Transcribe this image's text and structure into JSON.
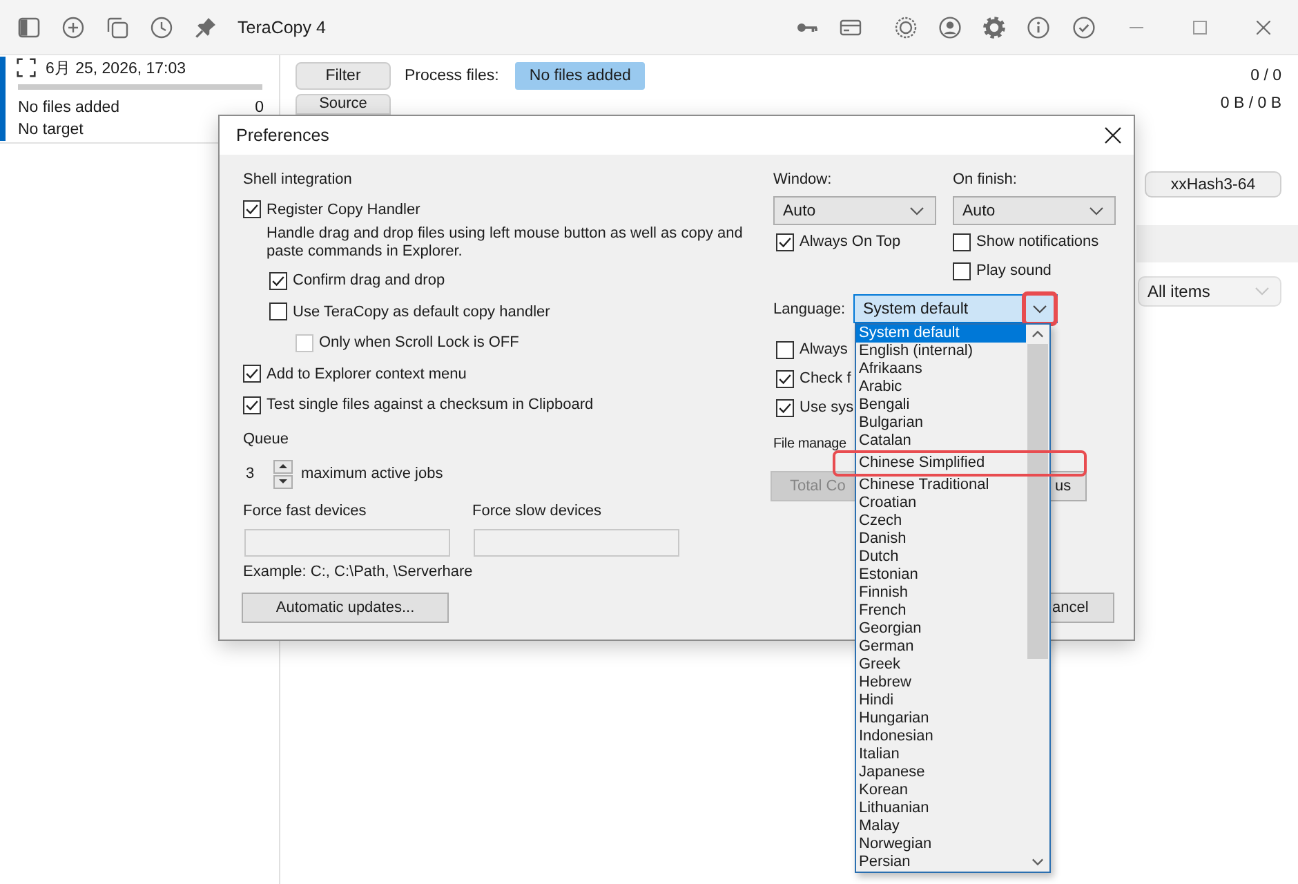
{
  "window": {
    "title": "TeraCopy 4"
  },
  "sidebar": {
    "jobs": [
      {
        "date": "6月 25, 2026, 17:03",
        "level": 0,
        "status": "No files added",
        "count": "0",
        "target": "No target",
        "selected": true
      }
    ]
  },
  "main": {
    "filter_button": "Filter",
    "process_label": "Process files:",
    "process_status": "No files added",
    "file_count": "0 / 0",
    "source_button": "Source",
    "size": "0 B / 0 B",
    "hash_button": "xxHash3-64",
    "view_select": "All items"
  },
  "dialog": {
    "title": "Preferences",
    "shell_integration": {
      "heading": "Shell integration",
      "options": [
        {
          "label": "Register Copy Handler",
          "checked": true,
          "disabled": false,
          "description": "Handle drag and drop files using left mouse button as well as copy and paste commands in Explorer.",
          "children": [
            {
              "label": "Confirm drag and drop",
              "checked": true,
              "disabled": false
            },
            {
              "label": "Use TeraCopy as default copy handler",
              "checked": false,
              "disabled": false,
              "children": [
                {
                  "label": "Only when Scroll Lock is OFF",
                  "checked": false,
                  "disabled": true
                }
              ]
            }
          ]
        },
        {
          "label": "Add to Explorer context menu",
          "checked": true,
          "disabled": false
        },
        {
          "label": "Test single files against a checksum in Clipboard",
          "checked": true,
          "disabled": false
        }
      ]
    },
    "queue": {
      "heading": "Queue",
      "value": "3",
      "label": "maximum active jobs"
    },
    "devices": [
      {
        "label": "Force fast devices"
      },
      {
        "label": "Force slow devices"
      }
    ],
    "example": "Example: C:, C:\\Path, \\Serverhare",
    "updates_button": "Automatic updates...",
    "window_select": {
      "label": "Window:",
      "value": "Auto",
      "options": [
        {
          "label": "Always On Top",
          "checked": true
        }
      ]
    },
    "finish_select": {
      "label": "On finish:",
      "value": "Auto",
      "options": [
        {
          "label": "Show notifications",
          "checked": false
        },
        {
          "label": "Play sound",
          "checked": false
        }
      ]
    },
    "language": {
      "label": "Language:",
      "value": "System default",
      "expanded": true,
      "highlighted": true,
      "options": [
        {
          "label": "System default",
          "selected": true,
          "highlighted": false
        },
        {
          "label": "English (internal)",
          "selected": false,
          "highlighted": false
        },
        {
          "label": "Afrikaans",
          "selected": false,
          "highlighted": false
        },
        {
          "label": "Arabic",
          "selected": false,
          "highlighted": false
        },
        {
          "label": "Bengali",
          "selected": false,
          "highlighted": false
        },
        {
          "label": "Bulgarian",
          "selected": false,
          "highlighted": false
        },
        {
          "label": "Catalan",
          "selected": false,
          "highlighted": false
        },
        {
          "label": "Chinese Simplified",
          "selected": false,
          "highlighted": true
        },
        {
          "label": "Chinese Traditional",
          "selected": false,
          "highlighted": false
        },
        {
          "label": "Croatian",
          "selected": false,
          "highlighted": false
        },
        {
          "label": "Czech",
          "selected": false,
          "highlighted": false
        },
        {
          "label": "Danish",
          "selected": false,
          "highlighted": false
        },
        {
          "label": "Dutch",
          "selected": false,
          "highlighted": false
        },
        {
          "label": "Estonian",
          "selected": false,
          "highlighted": false
        },
        {
          "label": "Finnish",
          "selected": false,
          "highlighted": false
        },
        {
          "label": "French",
          "selected": false,
          "highlighted": false
        },
        {
          "label": "Georgian",
          "selected": false,
          "highlighted": false
        },
        {
          "label": "German",
          "selected": false,
          "highlighted": false
        },
        {
          "label": "Greek",
          "selected": false,
          "highlighted": false
        },
        {
          "label": "Hebrew",
          "selected": false,
          "highlighted": false
        },
        {
          "label": "Hindi",
          "selected": false,
          "highlighted": false
        },
        {
          "label": "Hungarian",
          "selected": false,
          "highlighted": false
        },
        {
          "label": "Indonesian",
          "selected": false,
          "highlighted": false
        },
        {
          "label": "Italian",
          "selected": false,
          "highlighted": false
        },
        {
          "label": "Japanese",
          "selected": false,
          "highlighted": false
        },
        {
          "label": "Korean",
          "selected": false,
          "highlighted": false
        },
        {
          "label": "Lithuanian",
          "selected": false,
          "highlighted": false
        },
        {
          "label": "Malay",
          "selected": false,
          "highlighted": false
        },
        {
          "label": "Norwegian",
          "selected": false,
          "highlighted": false
        },
        {
          "label": "Persian",
          "selected": false,
          "highlighted": false
        }
      ]
    },
    "more_options": [
      {
        "label": "Always",
        "checked": false
      },
      {
        "label": "Check f",
        "checked": true
      },
      {
        "label": "Use sys",
        "checked": true
      }
    ],
    "file_manager": {
      "label": "File manage",
      "buttons": [
        {
          "label": "Total Co",
          "disabled": true
        },
        {
          "label": "us",
          "disabled": false
        }
      ]
    },
    "cancel_button": "ancel"
  }
}
